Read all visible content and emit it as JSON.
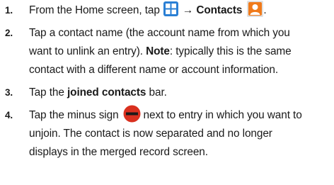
{
  "steps": [
    {
      "number": "1.",
      "pre": "From the Home screen, tap",
      "arrow": "→",
      "bold": "Contacts",
      "icons": [
        "apps-grid-icon",
        "contacts-app-icon"
      ]
    },
    {
      "number": "2.",
      "line1": "Tap a contact name (the account name from which you",
      "line2_pre": "want to unlink an entry). ",
      "note_label": "Note",
      "line2_post": ": typically this is the same",
      "line3": "contact with a different name or account information."
    },
    {
      "number": "3.",
      "pre": "Tap the ",
      "bold": "joined contacts",
      "post": " bar."
    },
    {
      "number": "4.",
      "pre": "Tap the minus sign",
      "post": "next to entry in which you want to",
      "line2": "unjoin. The contact is now separated and no longer",
      "line3": "displays in the merged record screen.",
      "icons": [
        "minus-circle-icon"
      ]
    }
  ],
  "colors": {
    "text": "#1a1a1a",
    "grid_icon_blue": "#2a7fd4",
    "contacts_icon_orange": "#f07a1a",
    "minus_icon_red": "#d9301f"
  }
}
